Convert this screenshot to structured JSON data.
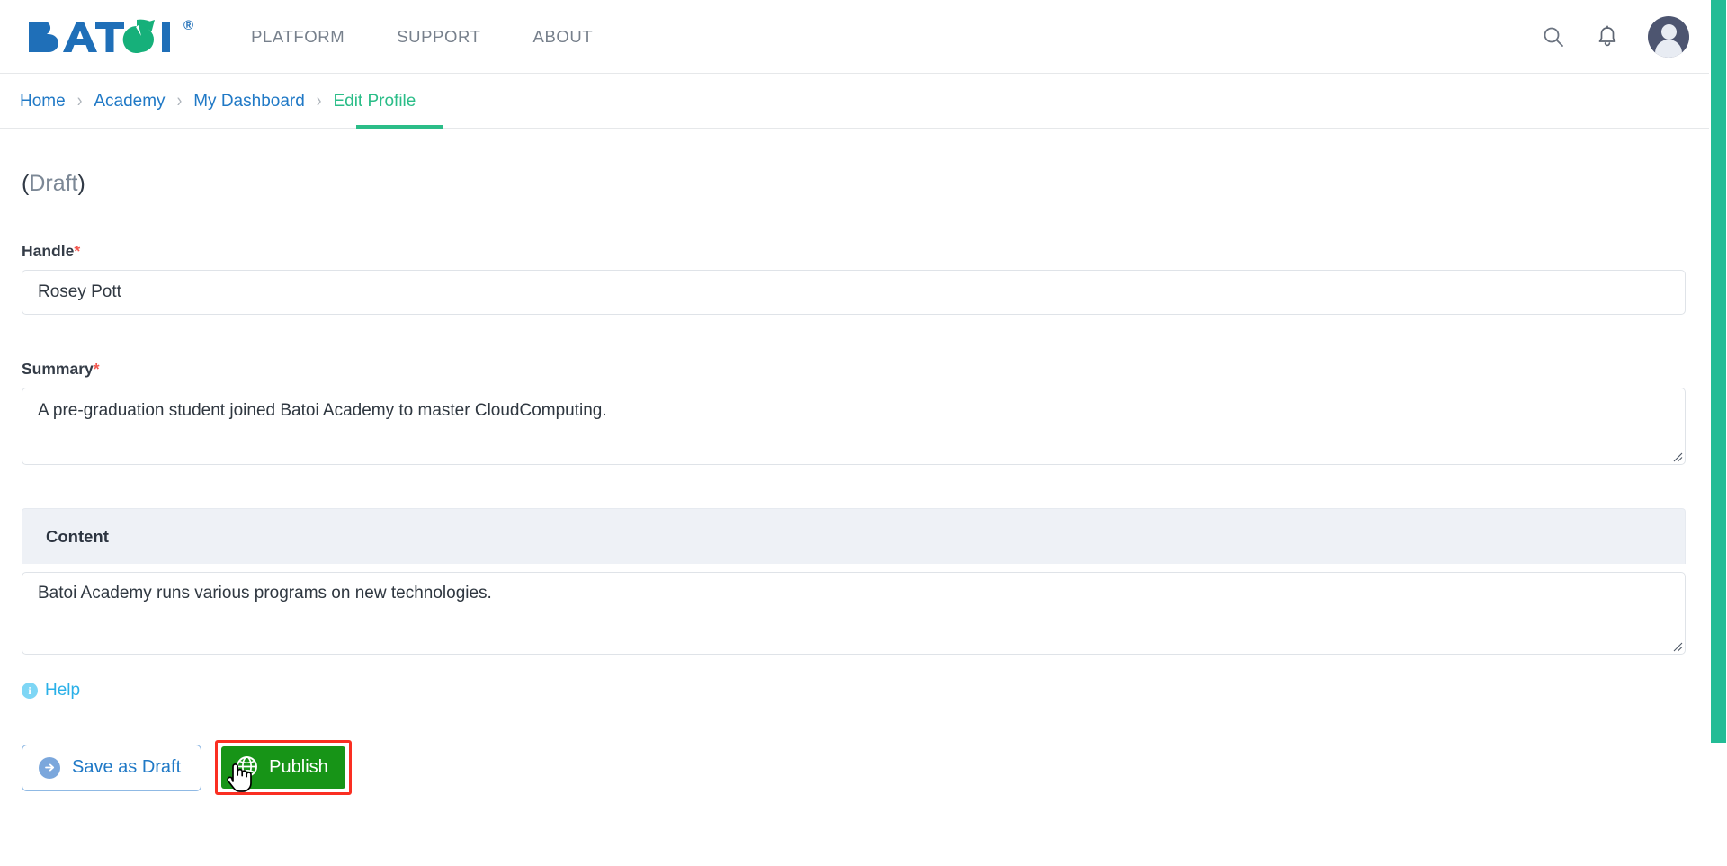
{
  "header": {
    "logo_text": "BATOI",
    "logo_registered": "®",
    "nav": [
      {
        "label": "PLATFORM"
      },
      {
        "label": "SUPPORT"
      },
      {
        "label": "ABOUT"
      }
    ],
    "search_icon": "search-icon",
    "notifications_icon": "bell-icon",
    "avatar_alt": "user-avatar"
  },
  "breadcrumb": {
    "items": [
      {
        "label": "Home",
        "active": false
      },
      {
        "label": "Academy",
        "active": false
      },
      {
        "label": "My Dashboard",
        "active": false
      },
      {
        "label": "Edit Profile",
        "active": true
      }
    ],
    "separator": "›"
  },
  "main": {
    "status_open": "(",
    "status_text": "Draft",
    "status_close": ")",
    "handle": {
      "label": "Handle",
      "required_mark": "*",
      "value": "Rosey Pott",
      "placeholder": ""
    },
    "summary": {
      "label": "Summary",
      "required_mark": "*",
      "value": "A pre-graduation student joined Batoi Academy to master CloudComputing.",
      "placeholder": ""
    },
    "content": {
      "panel_title": "Content",
      "value": "Batoi Academy runs various programs on new technologies.",
      "placeholder": ""
    },
    "help": {
      "icon_char": "i",
      "label": "Help"
    },
    "buttons": {
      "save_draft_label": "Save as Draft",
      "publish_label": "Publish"
    }
  },
  "colors": {
    "brand_blue": "#2079c6",
    "brand_green": "#2bbd88",
    "publish_green": "#179417",
    "highlight_red": "#fa2f22",
    "required_red": "#f2564d",
    "scrollbar_green": "#23bc96",
    "panel_header_bg": "#eef1f6"
  }
}
